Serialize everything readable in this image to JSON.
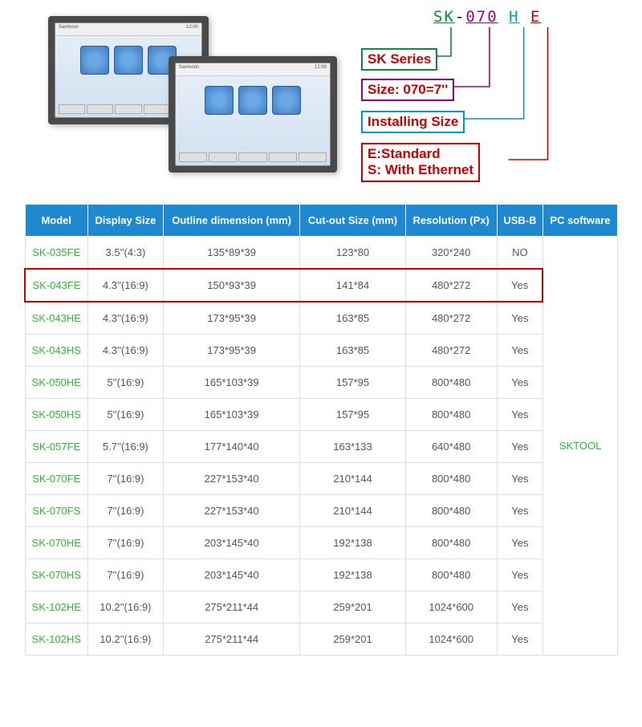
{
  "naming": {
    "code_sk": "SK",
    "code_dash": "-",
    "code_070": "070",
    "code_h": "H",
    "code_e": "E",
    "box_sk": "SK Series",
    "box_size": "Size: 070=7''",
    "box_install": "Installing Size",
    "box_e_label": "E:",
    "box_e_text": "Standard",
    "box_s_label": "S:",
    "box_s_text": " With Ethernet"
  },
  "table": {
    "headers": {
      "model": "Model",
      "display": "Display Size",
      "outline": "Outline dimension (mm)",
      "cutout": "Cut-out Size (mm)",
      "resolution": "Resolution (Px)",
      "usb": "USB-B",
      "pcsw": "PC software"
    },
    "pc_software": "SKTOOL",
    "rows": [
      {
        "model": "SK-035FE",
        "display": "3.5''(4:3)",
        "outline": "135*89*39",
        "cutout": "123*80",
        "res": "320*240",
        "usb": "NO",
        "highlight": false
      },
      {
        "model": "SK-043FE",
        "display": "4.3''(16:9)",
        "outline": "150*93*39",
        "cutout": "141*84",
        "res": "480*272",
        "usb": "Yes",
        "highlight": true
      },
      {
        "model": "SK-043HE",
        "display": "4.3''(16:9)",
        "outline": "173*95*39",
        "cutout": "163*85",
        "res": "480*272",
        "usb": "Yes",
        "highlight": false
      },
      {
        "model": "SK-043HS",
        "display": "4.3''(16:9)",
        "outline": "173*95*39",
        "cutout": "163*85",
        "res": "480*272",
        "usb": "Yes",
        "highlight": false
      },
      {
        "model": "SK-050HE",
        "display": "5''(16:9)",
        "outline": "165*103*39",
        "cutout": "157*95",
        "res": "800*480",
        "usb": "Yes",
        "highlight": false
      },
      {
        "model": "SK-050HS",
        "display": "5''(16:9)",
        "outline": "165*103*39",
        "cutout": "157*95",
        "res": "800*480",
        "usb": "Yes",
        "highlight": false
      },
      {
        "model": "SK-057FE",
        "display": "5.7''(16:9)",
        "outline": "177*140*40",
        "cutout": "163*133",
        "res": "640*480",
        "usb": "Yes",
        "highlight": false
      },
      {
        "model": "SK-070FE",
        "display": "7''(16:9)",
        "outline": "227*153*40",
        "cutout": "210*144",
        "res": "800*480",
        "usb": "Yes",
        "highlight": false
      },
      {
        "model": "SK-070FS",
        "display": "7''(16:9)",
        "outline": "227*153*40",
        "cutout": "210*144",
        "res": "800*480",
        "usb": "Yes",
        "highlight": false
      },
      {
        "model": "SK-070HE",
        "display": "7''(16:9)",
        "outline": "203*145*40",
        "cutout": "192*138",
        "res": "800*480",
        "usb": "Yes",
        "highlight": false
      },
      {
        "model": "SK-070HS",
        "display": "7''(16:9)",
        "outline": "203*145*40",
        "cutout": "192*138",
        "res": "800*480",
        "usb": "Yes",
        "highlight": false
      },
      {
        "model": "SK-102HE",
        "display": "10.2''(16:9)",
        "outline": "275*211*44",
        "cutout": "259*201",
        "res": "1024*600",
        "usb": "Yes",
        "highlight": false
      },
      {
        "model": "SK-102HS",
        "display": "10.2''(16:9)",
        "outline": "275*211*44",
        "cutout": "259*201",
        "res": "1024*600",
        "usb": "Yes",
        "highlight": false
      }
    ]
  }
}
